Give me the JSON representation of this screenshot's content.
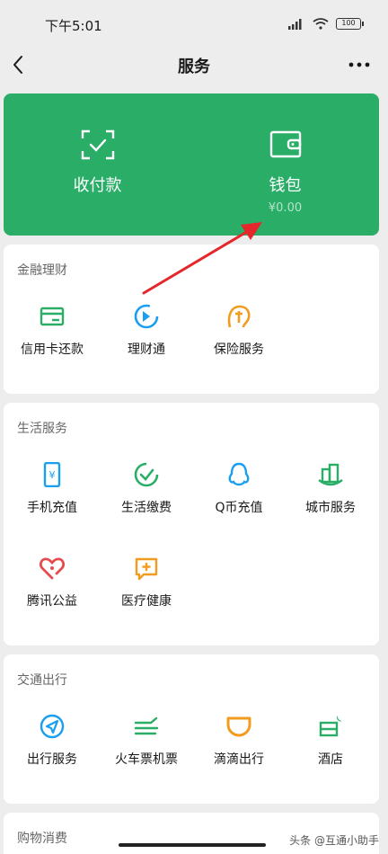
{
  "status": {
    "time": "下午5:01",
    "battery": "100"
  },
  "nav": {
    "title": "服务"
  },
  "hero": {
    "pay_label": "收付款",
    "wallet_label": "钱包",
    "wallet_balance": "¥0.00"
  },
  "finance": {
    "title": "金融理财",
    "items": [
      {
        "label": "信用卡还款"
      },
      {
        "label": "理财通"
      },
      {
        "label": "保险服务"
      }
    ]
  },
  "life": {
    "title": "生活服务",
    "items": [
      {
        "label": "手机充值"
      },
      {
        "label": "生活缴费"
      },
      {
        "label": "Q币充值"
      },
      {
        "label": "城市服务"
      },
      {
        "label": "腾讯公益"
      },
      {
        "label": "医疗健康"
      }
    ]
  },
  "travel": {
    "title": "交通出行",
    "items": [
      {
        "label": "出行服务"
      },
      {
        "label": "火车票机票"
      },
      {
        "label": "滴滴出行"
      },
      {
        "label": "酒店"
      }
    ]
  },
  "shopping": {
    "title": "购物消费"
  },
  "watermark": "头条 @互通小助手",
  "colors": {
    "green": "#2aae67",
    "blue": "#1a9ef0",
    "orange": "#f29c1f",
    "red": "#e34d4d",
    "arrow": "#e5262b"
  }
}
